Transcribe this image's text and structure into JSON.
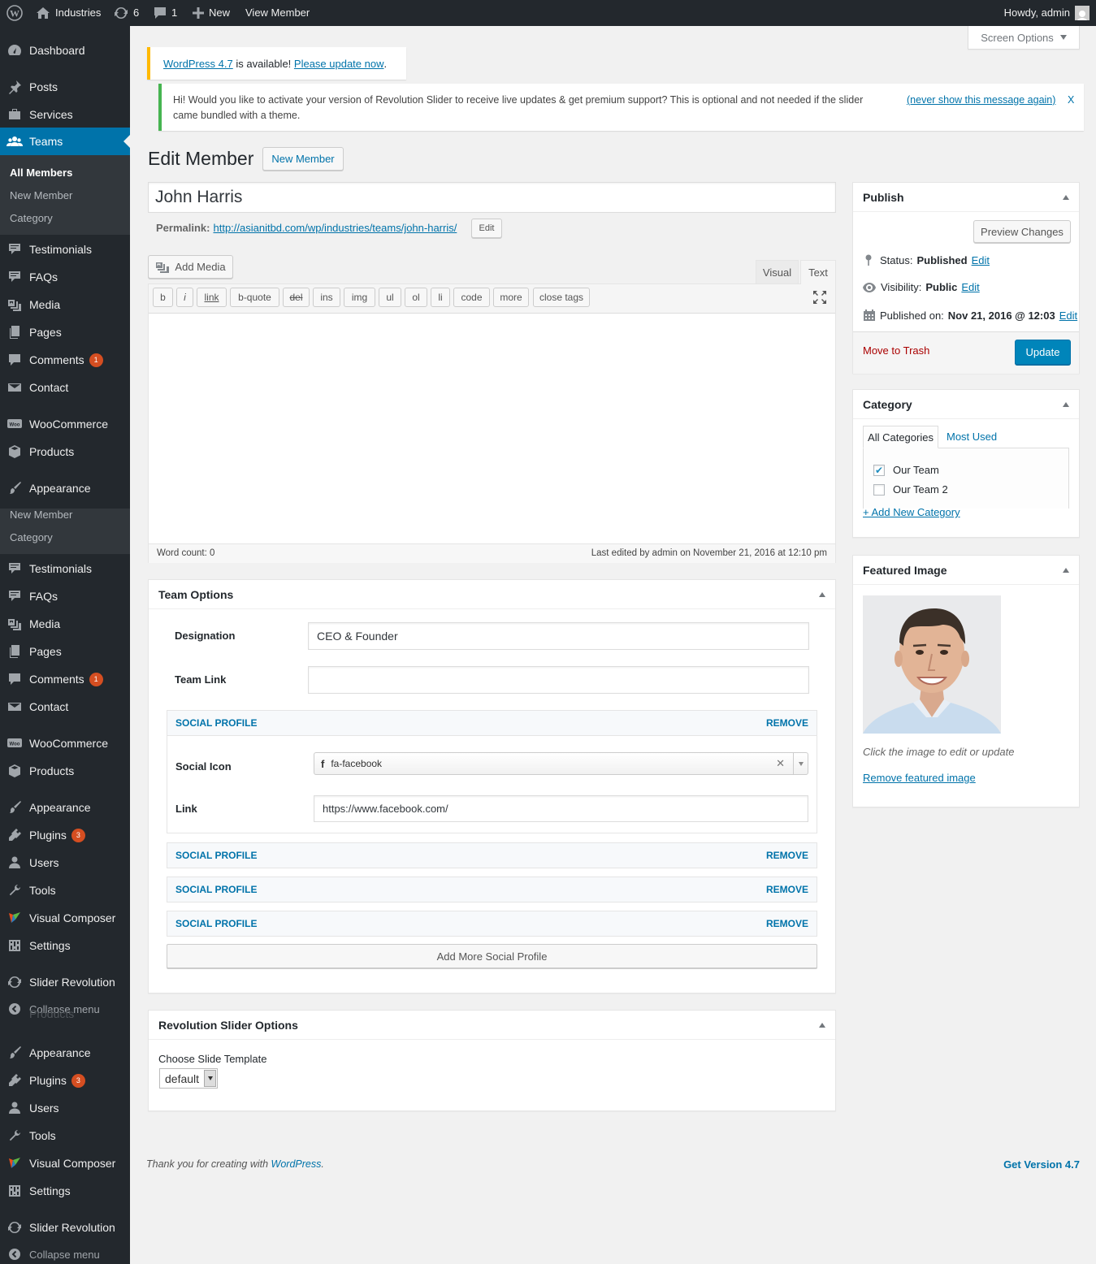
{
  "admin_bar": {
    "site_name": "Industries",
    "updates_count": "6",
    "comments_count": "1",
    "new_label": "New",
    "view_label": "View Member",
    "howdy": "Howdy, admin"
  },
  "sidebar": {
    "dashboard": "Dashboard",
    "posts": "Posts",
    "services": "Services",
    "teams": "Teams",
    "teams_sub": [
      "All Members",
      "New Member",
      "Category"
    ],
    "testimonials": "Testimonials",
    "faqs": "FAQs",
    "media": "Media",
    "pages": "Pages",
    "comments": "Comments",
    "comments_badge": "1",
    "contact": "Contact",
    "woocommerce": "WooCommerce",
    "products": "Products",
    "appearance": "Appearance",
    "plugins": "Plugins",
    "plugins_badge": "3",
    "users": "Users",
    "tools": "Tools",
    "visual_composer": "Visual Composer",
    "settings": "Settings",
    "slider_revolution": "Slider Revolution",
    "collapse": "Collapse menu",
    "ghost_sub": [
      "New Member",
      "Category"
    ],
    "ghost_products": "Products"
  },
  "screen_options": "Screen Options",
  "notice_update": {
    "link1": "WordPress 4.7",
    "mid": " is available! ",
    "link2": "Please update now",
    "end": "."
  },
  "notice_revslider": {
    "text": "Hi! Would you like to activate your version of Revolution Slider to receive live updates & get premium support? This is optional and not needed if the slider came bundled with a theme.",
    "dismiss": "(never show this message again)",
    "x": "X"
  },
  "page": {
    "title": "Edit Member",
    "new_button": "New Member"
  },
  "editor": {
    "post_title": "John Harris",
    "permalink_label": "Permalink:",
    "permalink_url": "http://asianitbd.com/wp/industries/teams/john-harris/",
    "permalink_edit": "Edit",
    "add_media": "Add Media",
    "tab_visual": "Visual",
    "tab_text": "Text",
    "quicktags": [
      "b",
      "i",
      "link",
      "b-quote",
      "del",
      "ins",
      "img",
      "ul",
      "ol",
      "li",
      "code",
      "more",
      "close tags"
    ],
    "word_count": "Word count: 0",
    "last_edited": "Last edited by admin on November 21, 2016 at 12:10 pm"
  },
  "team_options": {
    "title": "Team Options",
    "designation_label": "Designation",
    "designation_value": "CEO & Founder",
    "team_link_label": "Team Link",
    "team_link_value": "",
    "social_profile": "SOCIAL PROFILE",
    "remove": "REMOVE",
    "social_icon_label": "Social Icon",
    "social_icon_value": "fa-facebook",
    "link_label": "Link",
    "link_value": "https://www.facebook.com/",
    "add_more": "Add More Social Profile"
  },
  "rev_options": {
    "title": "Revolution Slider Options",
    "template_label": "Choose Slide Template",
    "template_value": "default"
  },
  "publish": {
    "title": "Publish",
    "preview": "Preview Changes",
    "status_label": "Status:",
    "status_value": "Published",
    "visibility_label": "Visibility:",
    "visibility_value": "Public",
    "published_label": "Published on:",
    "published_value": "Nov 21, 2016 @ 12:03",
    "edit": "Edit",
    "trash": "Move to Trash",
    "update": "Update"
  },
  "category": {
    "title": "Category",
    "tab_all": "All Categories",
    "tab_used": "Most Used",
    "items": [
      {
        "label": "Our Team",
        "checked": true
      },
      {
        "label": "Our Team 2",
        "checked": false
      }
    ],
    "add_new": "+ Add New Category"
  },
  "featured": {
    "title": "Featured Image",
    "hint": "Click the image to edit or update",
    "remove": "Remove featured image"
  },
  "footer": {
    "thanks_prefix": "Thank you for creating with ",
    "wp_link": "WordPress",
    "thanks_suffix": ".",
    "version": "Get Version 4.7"
  },
  "colors": {
    "admin_dark": "#23282d",
    "submenu": "#32373c",
    "accent": "#0073aa",
    "badge": "#d54e21",
    "trash": "#a00"
  }
}
